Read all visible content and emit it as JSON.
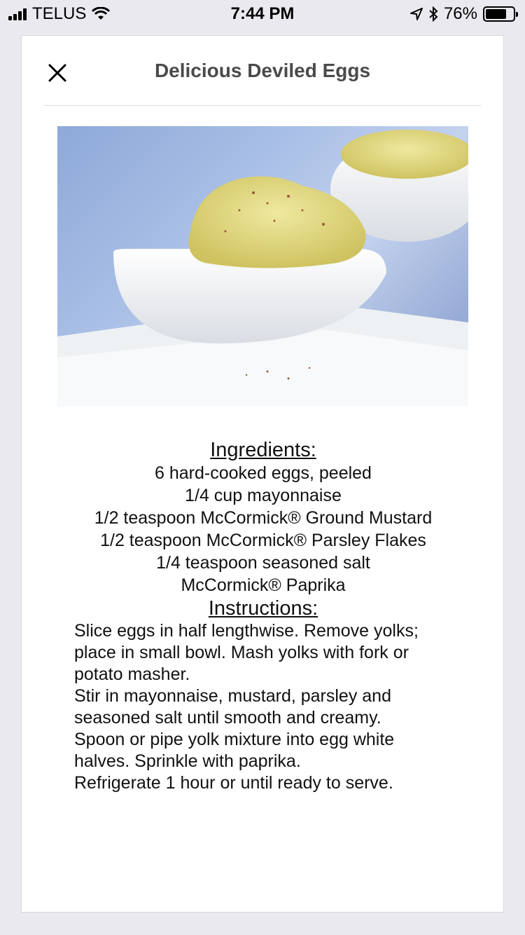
{
  "status_bar": {
    "carrier": "TELUS",
    "time": "7:44 PM",
    "battery": "76%",
    "battery_level": 0.76
  },
  "recipe": {
    "title": "Delicious Deviled Eggs",
    "ingredients_heading": "Ingredients:",
    "ingredients": [
      "6 hard-cooked eggs, peeled",
      "1/4 cup mayonnaise",
      "1/2 teaspoon McCormick® Ground Mustard",
      "1/2 teaspoon McCormick® Parsley Flakes",
      "1/4 teaspoon seasoned salt",
      "McCormick® Paprika"
    ],
    "instructions_heading": "Instructions:",
    "instructions": [
      "Slice eggs in half lengthwise. Remove yolks;",
      "place in small bowl. Mash yolks with fork or",
      "potato masher.",
      "Stir in mayonnaise, mustard, parsley and",
      "seasoned salt until smooth and creamy.",
      "Spoon or pipe yolk mixture into egg white",
      "halves. Sprinkle with paprika.",
      "Refrigerate 1 hour or until ready to serve."
    ]
  },
  "icons": {
    "close": "close-icon",
    "signal": "signal-icon",
    "wifi": "wifi-icon",
    "location": "location-icon",
    "bluetooth": "bluetooth-icon",
    "battery": "battery-icon"
  }
}
